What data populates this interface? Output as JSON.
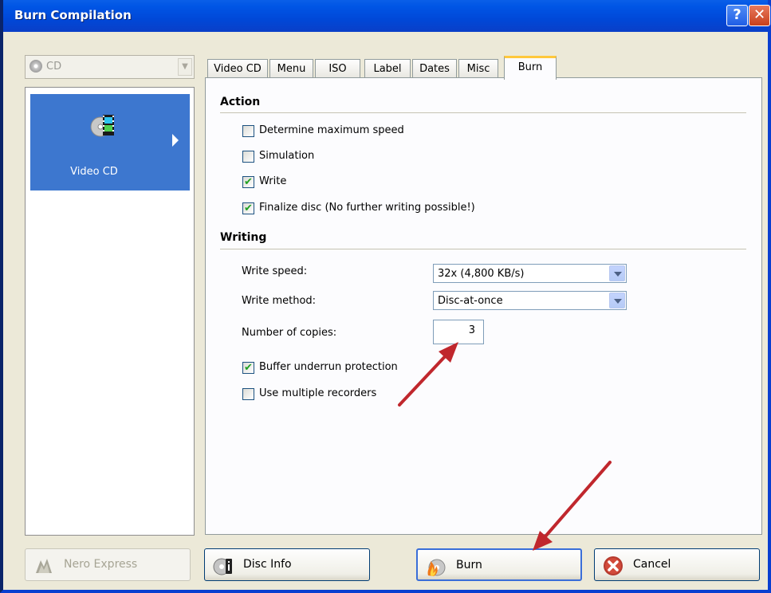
{
  "window": {
    "title": "Burn Compilation",
    "help_glyph": "?",
    "close_glyph": "✕"
  },
  "media_combo": {
    "value": "CD",
    "icon": "cd-disc-icon"
  },
  "sidebar": {
    "items": [
      {
        "label": "Video CD",
        "icon": "video-cd-icon",
        "selected": true
      }
    ]
  },
  "tabs": [
    {
      "label": "Video CD"
    },
    {
      "label": "Menu"
    },
    {
      "label": "ISO"
    },
    {
      "label": "Label"
    },
    {
      "label": "Dates"
    },
    {
      "label": "Misc"
    },
    {
      "label": "Burn",
      "active": true
    }
  ],
  "burn_tab": {
    "action": {
      "heading": "Action",
      "options": [
        {
          "label": "Determine maximum speed",
          "checked": false
        },
        {
          "label": "Simulation",
          "checked": false
        },
        {
          "label": "Write",
          "checked": true
        },
        {
          "label": "Finalize disc (No further writing possible!)",
          "checked": true
        }
      ]
    },
    "writing": {
      "heading": "Writing",
      "write_speed_label": "Write speed:",
      "write_speed_value": "32x (4,800 KB/s)",
      "write_method_label": "Write method:",
      "write_method_value": "Disc-at-once",
      "copies_label": "Number of copies:",
      "copies_value": "3",
      "options": [
        {
          "label": "Buffer underrun protection",
          "checked": true
        },
        {
          "label": "Use multiple recorders",
          "checked": false
        }
      ]
    }
  },
  "footer": {
    "nero_express": "Nero Express",
    "disc_info": "Disc Info",
    "burn": "Burn",
    "cancel": "Cancel"
  },
  "colors": {
    "titlebar": "#0055e5",
    "selection": "#3d77cf",
    "tab_highlight": "#ffc83c",
    "annotation_arrow": "#c0272d",
    "check_mark": "#21a121"
  }
}
